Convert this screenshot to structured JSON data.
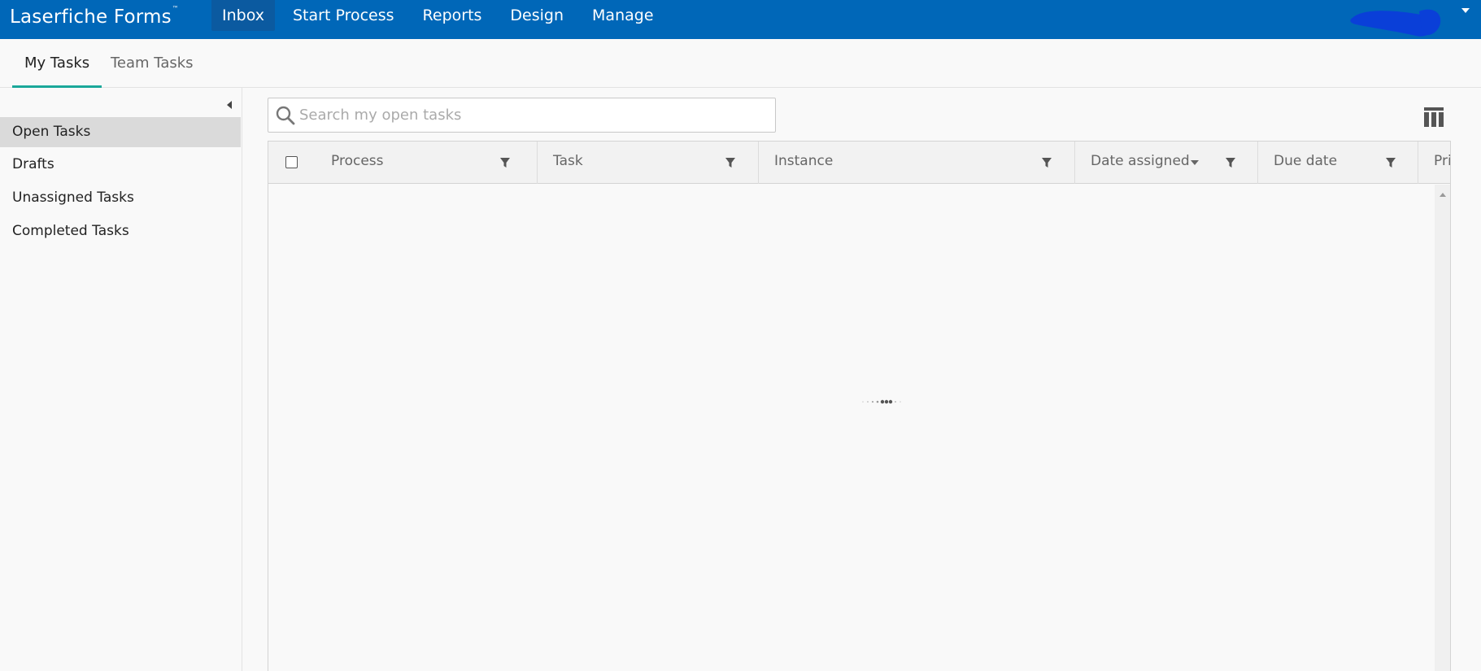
{
  "header": {
    "brand": "Laserfiche Forms",
    "trademark": "™",
    "nav": [
      {
        "label": "Inbox",
        "active": true
      },
      {
        "label": "Start Process",
        "active": false
      },
      {
        "label": "Reports",
        "active": false
      },
      {
        "label": "Design",
        "active": false
      },
      {
        "label": "Manage",
        "active": false
      }
    ],
    "user_menu_icon": "chevron-down-icon"
  },
  "tabs": [
    {
      "label": "My Tasks",
      "active": true
    },
    {
      "label": "Team Tasks",
      "active": false
    }
  ],
  "sidebar": {
    "collapse_icon": "chevron-left-icon",
    "items": [
      {
        "label": "Open Tasks",
        "active": true
      },
      {
        "label": "Drafts",
        "active": false
      },
      {
        "label": "Unassigned Tasks",
        "active": false
      },
      {
        "label": "Completed Tasks",
        "active": false
      }
    ]
  },
  "search": {
    "placeholder": "Search my open tasks",
    "value": "",
    "icon": "search-icon"
  },
  "toolbar": {
    "columns_icon": "columns-icon"
  },
  "grid": {
    "columns": [
      {
        "label": "Process",
        "filter": true,
        "sorted": false
      },
      {
        "label": "Task",
        "filter": true,
        "sorted": false
      },
      {
        "label": "Instance",
        "filter": true,
        "sorted": false
      },
      {
        "label": "Date assigned",
        "filter": true,
        "sorted": true
      },
      {
        "label": "Due date",
        "filter": true,
        "sorted": false
      },
      {
        "label": "Pri",
        "filter": false,
        "sorted": false
      }
    ],
    "rows": [],
    "loading": true
  },
  "colors": {
    "header_bg": "#0067b8",
    "active_nav_bg": "#0b5aa0",
    "tab_accent": "#1ba89a",
    "sidebar_active_bg": "#dadada"
  }
}
